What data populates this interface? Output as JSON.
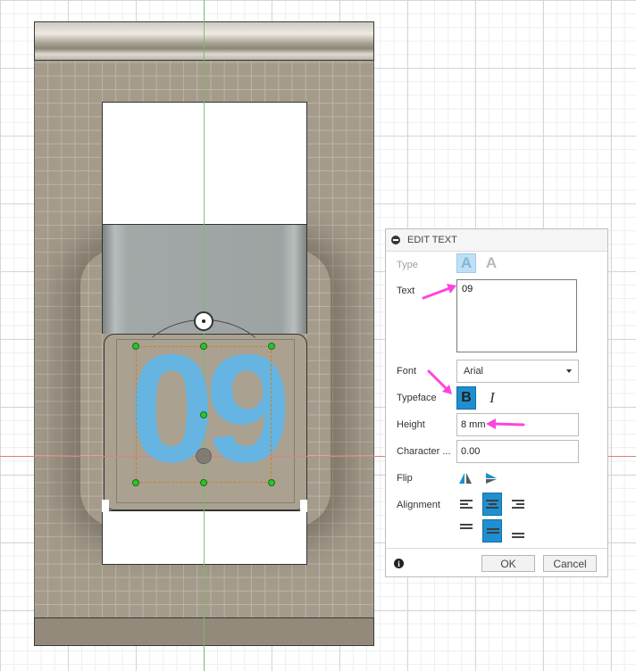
{
  "dialog": {
    "title": "EDIT TEXT",
    "labels": {
      "type": "Type",
      "text": "Text",
      "font": "Font",
      "typeface": "Typeface",
      "height": "Height",
      "character": "Character ...",
      "flip": "Flip",
      "alignment": "Alignment"
    },
    "text_value": "09",
    "font_value": "Arial",
    "height_value": "8 mm",
    "character_value": "0.00",
    "typeface": {
      "bold": "B",
      "italic": "I",
      "bold_active": true
    },
    "type_glyph": "A",
    "horizontal_alignment": "center",
    "vertical_alignment": "middle",
    "ok_label": "OK",
    "cancel_label": "Cancel",
    "info_glyph": "i"
  },
  "canvas": {
    "text_preview": "09"
  },
  "colors": {
    "accent": "#1e8fd0",
    "annotation": "#ff44dd",
    "text_preview": "#5ab8ef",
    "handle": "#2bc32b"
  },
  "icons": [
    "collapse-icon",
    "info-icon",
    "caret-down-icon",
    "flip-horizontal-icon",
    "flip-vertical-icon",
    "align-left-icon",
    "align-center-icon",
    "align-right-icon",
    "align-top-icon",
    "align-middle-icon",
    "align-bottom-icon"
  ]
}
